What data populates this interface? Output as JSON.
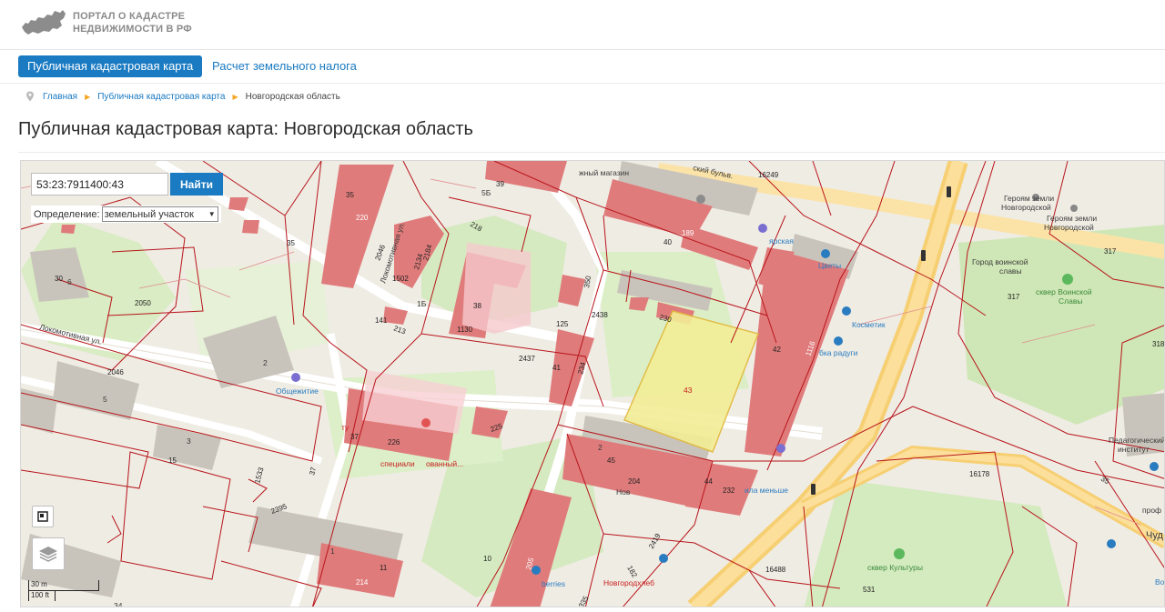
{
  "header": {
    "logo_line1": "ПОРТАЛ О КАДАСТРЕ",
    "logo_line2": "НЕДВИЖИМОСТИ В РФ"
  },
  "nav": {
    "active_tab": "Публичная кадастровая карта",
    "second_tab": "Расчет земельного налога"
  },
  "breadcrumb": {
    "home": "Главная",
    "section": "Публичная кадастровая карта",
    "current": "Новгородская область"
  },
  "page_title": "Публичная кадастровая карта: Новгородская область",
  "map": {
    "search_value": "53:23:7911400:43",
    "search_button": "Найти",
    "definition_label": "Определение:",
    "definition_value": "земельный участок",
    "scale_metric": "30 m",
    "scale_imperial": "100 ft",
    "parcel_labels": {
      "p35a": "35",
      "p220": "220",
      "p2046a": "2046",
      "p35b": "35",
      "p2184": "2184",
      "p2134": "2134",
      "p218": "218",
      "p5b": "5Б",
      "p39": "39",
      "p1502": "1502",
      "p1b": "1Б",
      "p38": "38",
      "p1130": "1130",
      "p141": "141",
      "p213": "213",
      "p30": "30",
      "p6": "6",
      "p2050": "2050",
      "p2": "2",
      "p2046b": "2046",
      "p5": "5",
      "p3": "3",
      "p15": "15",
      "p1533": "1533",
      "p37a": "37",
      "p2395": "2395",
      "p37b": "37",
      "p226": "226",
      "p225": "225",
      "p2437": "2437",
      "p41": "41",
      "p234": "234",
      "p125": "125",
      "p2438": "2438",
      "p350": "350",
      "p230": "230",
      "p43": "43",
      "p40": "40",
      "p189": "189",
      "p16249": "16249",
      "p42": "42",
      "p1116": "1116",
      "p45": "45",
      "p204": "204",
      "p44": "44",
      "p232": "232",
      "p2a": "2",
      "p10": "10",
      "p205": "205",
      "p2419": "2419",
      "p182": "182",
      "p335": "335",
      "p16488": "16488",
      "p16178": "16178",
      "p35c": "35",
      "p317a": "317",
      "p317b": "317",
      "p318": "318",
      "p531": "531",
      "p11": "11",
      "p214": "214",
      "p1": "1",
      "p34": "34"
    },
    "poi_labels": {
      "street1": "Локомотивная ул.",
      "street2": "Локомотивная ул.",
      "street3": "ский бульв.",
      "shop": "жный магазин",
      "heroes1a": "Героям земли",
      "heroes1b": "Новгородской",
      "heroes2a": "Героям земли",
      "heroes2b": "Новгородской",
      "city": "Город воинской",
      "city2": "славы",
      "square1": "сквер Воинской",
      "square1b": "Славы",
      "square2": "сквер Культуры",
      "dorm": "Общежитие",
      "cosmetic": "Косметик",
      "rainbow": "бка радуги",
      "flowers": "Цветы",
      "hospital": "ованный...",
      "hospital2": "специали",
      "bakery": "Новгородхлеб",
      "wb": "berries",
      "less": "ила меньше",
      "nov": "Нов",
      "ped": "Педагогический",
      "inst": "институт",
      "chud": "Чуд",
      "prof": "проф",
      "tu": "ту",
      "ped2": "ярская",
      "vo": "Во"
    }
  },
  "colors": {
    "accent": "#1a7ac2",
    "building": "#e07777",
    "parcel_line": "#b8141a",
    "selected": "#f3ee96",
    "road": "#fbd98a",
    "park": "#cfe8b4"
  }
}
